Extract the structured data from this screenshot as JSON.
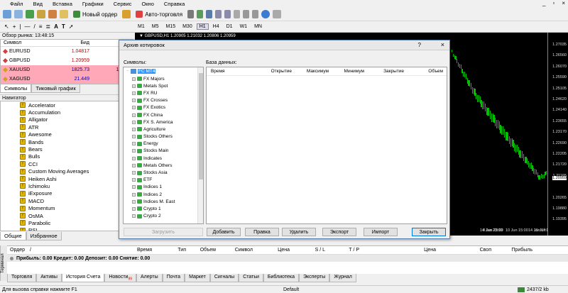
{
  "menu": [
    "Файл",
    "Вид",
    "Вставка",
    "Графики",
    "Сервис",
    "Окно",
    "Справка"
  ],
  "window_controls": {
    "min": "_",
    "restore": "▫",
    "close": "×"
  },
  "toolbar": {
    "new_order": "Новый ордер",
    "auto_trading": "Авто-торговля"
  },
  "timeframes": [
    "M1",
    "M5",
    "M15",
    "M30",
    "H1",
    "H4",
    "D1",
    "W1",
    "MN"
  ],
  "market_watch": {
    "title": "Обзор рынка: 13:48:15",
    "headers": {
      "symbol": "Символ",
      "bid": "Бид",
      "ask": "Аск"
    },
    "rows": [
      {
        "symbol": "EURUSD",
        "bid": "1.04817",
        "ask": "1.04",
        "color": "#c00000",
        "bg": "#ffffff"
      },
      {
        "symbol": "GBPUSD",
        "bid": "1.20959",
        "ask": "1.20",
        "color": "#c00000",
        "bg": "#ffffff"
      },
      {
        "symbol": "XAUUSD",
        "bid": "1825.73",
        "ask": "1825.",
        "color": "#0000cc",
        "bg": "#ffa8b8"
      },
      {
        "symbol": "XAGUSD",
        "bid": "21.449",
        "ask": "21.4",
        "color": "#0000cc",
        "bg": "#ffa8b8"
      }
    ],
    "tabs": [
      "Символы",
      "Тиковый график"
    ]
  },
  "navigator": {
    "title": "Навигатор",
    "items": [
      "Accelerator",
      "Accumulation",
      "Alligator",
      "ATR",
      "Awesome",
      "Bands",
      "Bears",
      "Bulls",
      "CCI",
      "Custom Moving Averages",
      "Heiken Ashi",
      "Ichimoku",
      "iExposure",
      "MACD",
      "Momentum",
      "OsMA",
      "Parabolic",
      "RSI"
    ],
    "tabs": [
      "Общие",
      "Избранное"
    ]
  },
  "chart": {
    "header": "▼ GBPUSD,H1  1.20905 1.21032 1.20806 1.20959",
    "y_ticks": [
      "1.27035",
      "1.26560",
      "1.26070",
      "1.25590",
      "1.25105",
      "1.24620",
      "1.24140",
      "1.23655",
      "1.23170",
      "1.22690",
      "1.22205",
      "1.21720",
      "1.21165",
      "1.20959",
      "1.20265",
      "1.19880",
      "1.19395"
    ],
    "current_price": "1.20959",
    "x_ticks": [
      "8 Jun 2022",
      "8 Jun 23:00",
      "10 Jun 15:00",
      "14 Jun 07:00",
      "15 Jun 23:00",
      "17 Jun 15:00",
      "21 Jun 07:00"
    ],
    "x_right": "14 Jun 23:00"
  },
  "dialog": {
    "title": "Архив котировок",
    "help": "?",
    "close": "×",
    "symbols_label": "Символы:",
    "db_label": "База данных:",
    "tree_root": "FC MT4",
    "tree_items": [
      "FX Majors",
      "Metals Spot",
      "FX RU",
      "FX Crosses",
      "FX Exotics",
      "FX China",
      "FX S. America",
      "Agriculture",
      "Stocks Others",
      "Energy",
      "Stocks Main",
      "Indicates",
      "Metals Others",
      "Stocks Asia",
      "ETF",
      "Indices 1",
      "Indices 2",
      "Indices M. East",
      "Crypto 1",
      "Crypto 2"
    ],
    "db_headers": [
      "Время",
      "Открытие",
      "Максимум",
      "Минимум",
      "Закрытие",
      "Объем"
    ],
    "buttons": {
      "load": "Загрузить",
      "add": "Добавить",
      "edit": "Правка",
      "delete": "Удалить",
      "export": "Экспорт",
      "import": "Импорт",
      "close": "Закрыть"
    }
  },
  "terminal": {
    "side_label": "Терминал",
    "headers": [
      "Ордер",
      "/",
      "Время",
      "Тип",
      "Объем",
      "Символ",
      "Цена",
      "S / L",
      "T / P",
      "Цена",
      "Своп",
      "Прибыль"
    ],
    "summary": "Прибыль: 0.00  Кредит: 0.00  Депозит: 0.00  Снятие: 0.00",
    "tabs": [
      "Торговля",
      "Активы",
      "История Счета",
      "Новости",
      "Алерты",
      "Почта",
      "Маркет",
      "Сигналы",
      "Статьи",
      "Библиотека",
      "Эксперты",
      "Журнал"
    ],
    "news_badge": "99"
  },
  "status": {
    "help": "Для вызова справки нажмите F1",
    "profile": "Default",
    "traffic": "2437/2 kb"
  }
}
